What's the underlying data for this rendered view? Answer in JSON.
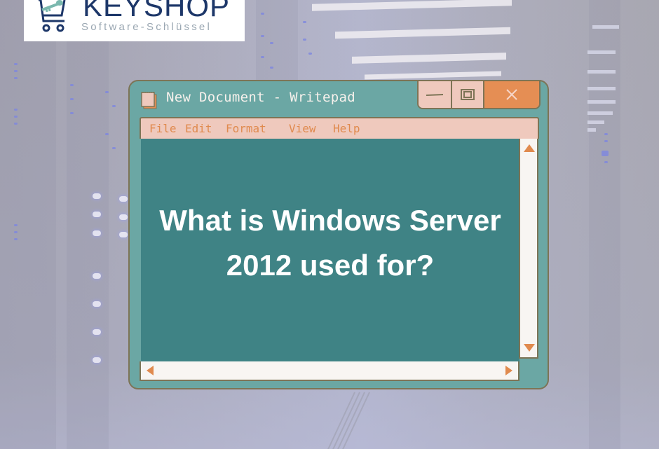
{
  "logo": {
    "title": "KEYSHOP",
    "subtitle": "Software-Schlüssel",
    "icon": "cart-key-icon"
  },
  "window": {
    "title": "New Document - Writepad",
    "icon": "notepad-icon",
    "controls": {
      "minimize": "minimize-icon",
      "maximize": "maximize-icon",
      "close": "close-icon"
    },
    "menu": [
      {
        "label": "File"
      },
      {
        "label": "Edit"
      },
      {
        "label": "Format"
      },
      {
        "label": "View"
      },
      {
        "label": "Help"
      }
    ],
    "content": {
      "line1": "What is Windows Server",
      "line2": "2012 used for?"
    }
  },
  "colors": {
    "window_frame": "#6ba7a4",
    "content_bg": "#3f8385",
    "menu_bg": "#efc9bd",
    "accent_orange": "#e58e54",
    "border": "#7d7456",
    "logo_navy": "#1d3769",
    "logo_teal": "#7ab8ae"
  }
}
